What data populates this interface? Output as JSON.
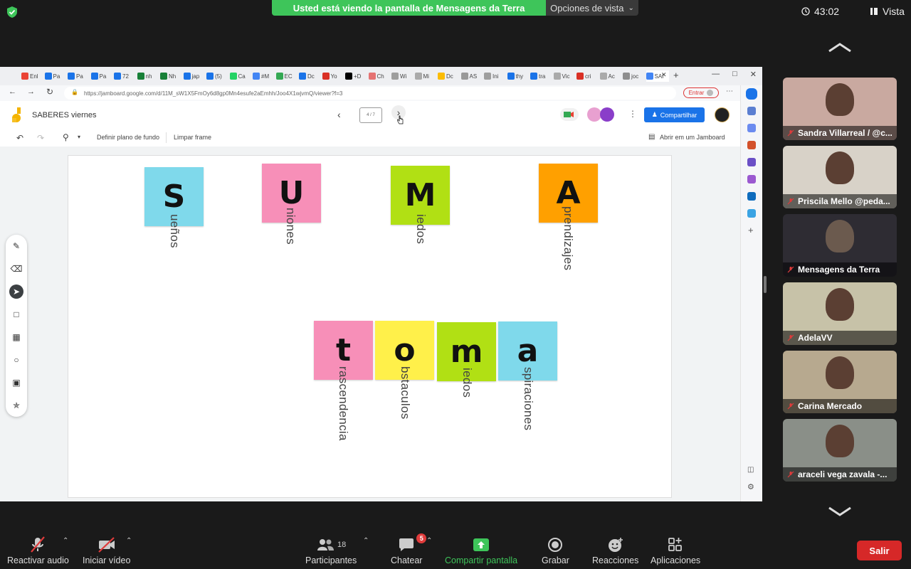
{
  "zoom": {
    "share_banner": "Usted está viendo la pantalla de Mensagens da Terra",
    "view_options": "Opciones de vista",
    "timer": "43:02",
    "view_label": "Vista"
  },
  "browser": {
    "tabs": [
      "Enl",
      "Pa",
      "Pa",
      "Pa",
      "72",
      "nh",
      "Nh",
      "jap",
      "(5)",
      "Ca",
      "#M",
      "EC",
      "Dc",
      "Yo",
      "+D",
      "Ch",
      "Wi",
      "Mi",
      "Dc",
      "AS",
      "Ini",
      "thy",
      "tra",
      "Vic",
      "cri",
      "Ac",
      "joc",
      "SAI"
    ],
    "url": "https://jamboard.google.com/d/11M_sW1X5FmOy6d8gp0Mn4esufe2aEmhh/Joo4X1wjvmQ/viewer?f=3",
    "signin_label": "Entrar"
  },
  "jamboard": {
    "title": "SABERES viernes",
    "frame_indicator": "4 / 7",
    "share_label": "Compartilhar",
    "set_background": "Definir plano de fundo",
    "clear_frame": "Limpar frame",
    "open_in_jamboard": "Abrir em um Jamboard",
    "notes_top": [
      {
        "letter": "S",
        "word": "ueños",
        "color": "#7fd9eb"
      },
      {
        "letter": "U",
        "word": "niones",
        "color": "#f78fb8"
      },
      {
        "letter": "M",
        "word": "iedos",
        "color": "#b1e014"
      },
      {
        "letter": "A",
        "word": "prendizajes",
        "color": "#ffa000"
      }
    ],
    "notes_bottom": [
      {
        "letter": "t",
        "word": "rascendencia",
        "color": "#f78fb8"
      },
      {
        "letter": "o",
        "word": "bstaculos",
        "color": "#fff04a"
      },
      {
        "letter": "m",
        "word": "iedos",
        "color": "#b1e014"
      },
      {
        "letter": "a",
        "word": "spiraciones",
        "color": "#7fd9eb"
      }
    ]
  },
  "participants": [
    {
      "name": "Sandra Villarreal / @c...",
      "bg": "#c9a9a0"
    },
    {
      "name": "Priscila Mello @peda...",
      "bg": "#d8d2c8"
    },
    {
      "name": "Mensagens da Terra",
      "bg": "#2e2c33"
    },
    {
      "name": "AdelaVV",
      "bg": "#c7c2a8"
    },
    {
      "name": "Carina Mercado",
      "bg": "#b7a98f"
    },
    {
      "name": "araceli vega zavala -...",
      "bg": "#8a8f88"
    }
  ],
  "bottom": {
    "unmute": "Reactivar audio",
    "start_video": "Iniciar vídeo",
    "participants": "Participantes",
    "participants_count": "18",
    "chat": "Chatear",
    "chat_badge": "5",
    "share_screen": "Compartir pantalla",
    "record": "Grabar",
    "reactions": "Reacciones",
    "apps": "Aplicaciones",
    "leave": "Salir"
  }
}
